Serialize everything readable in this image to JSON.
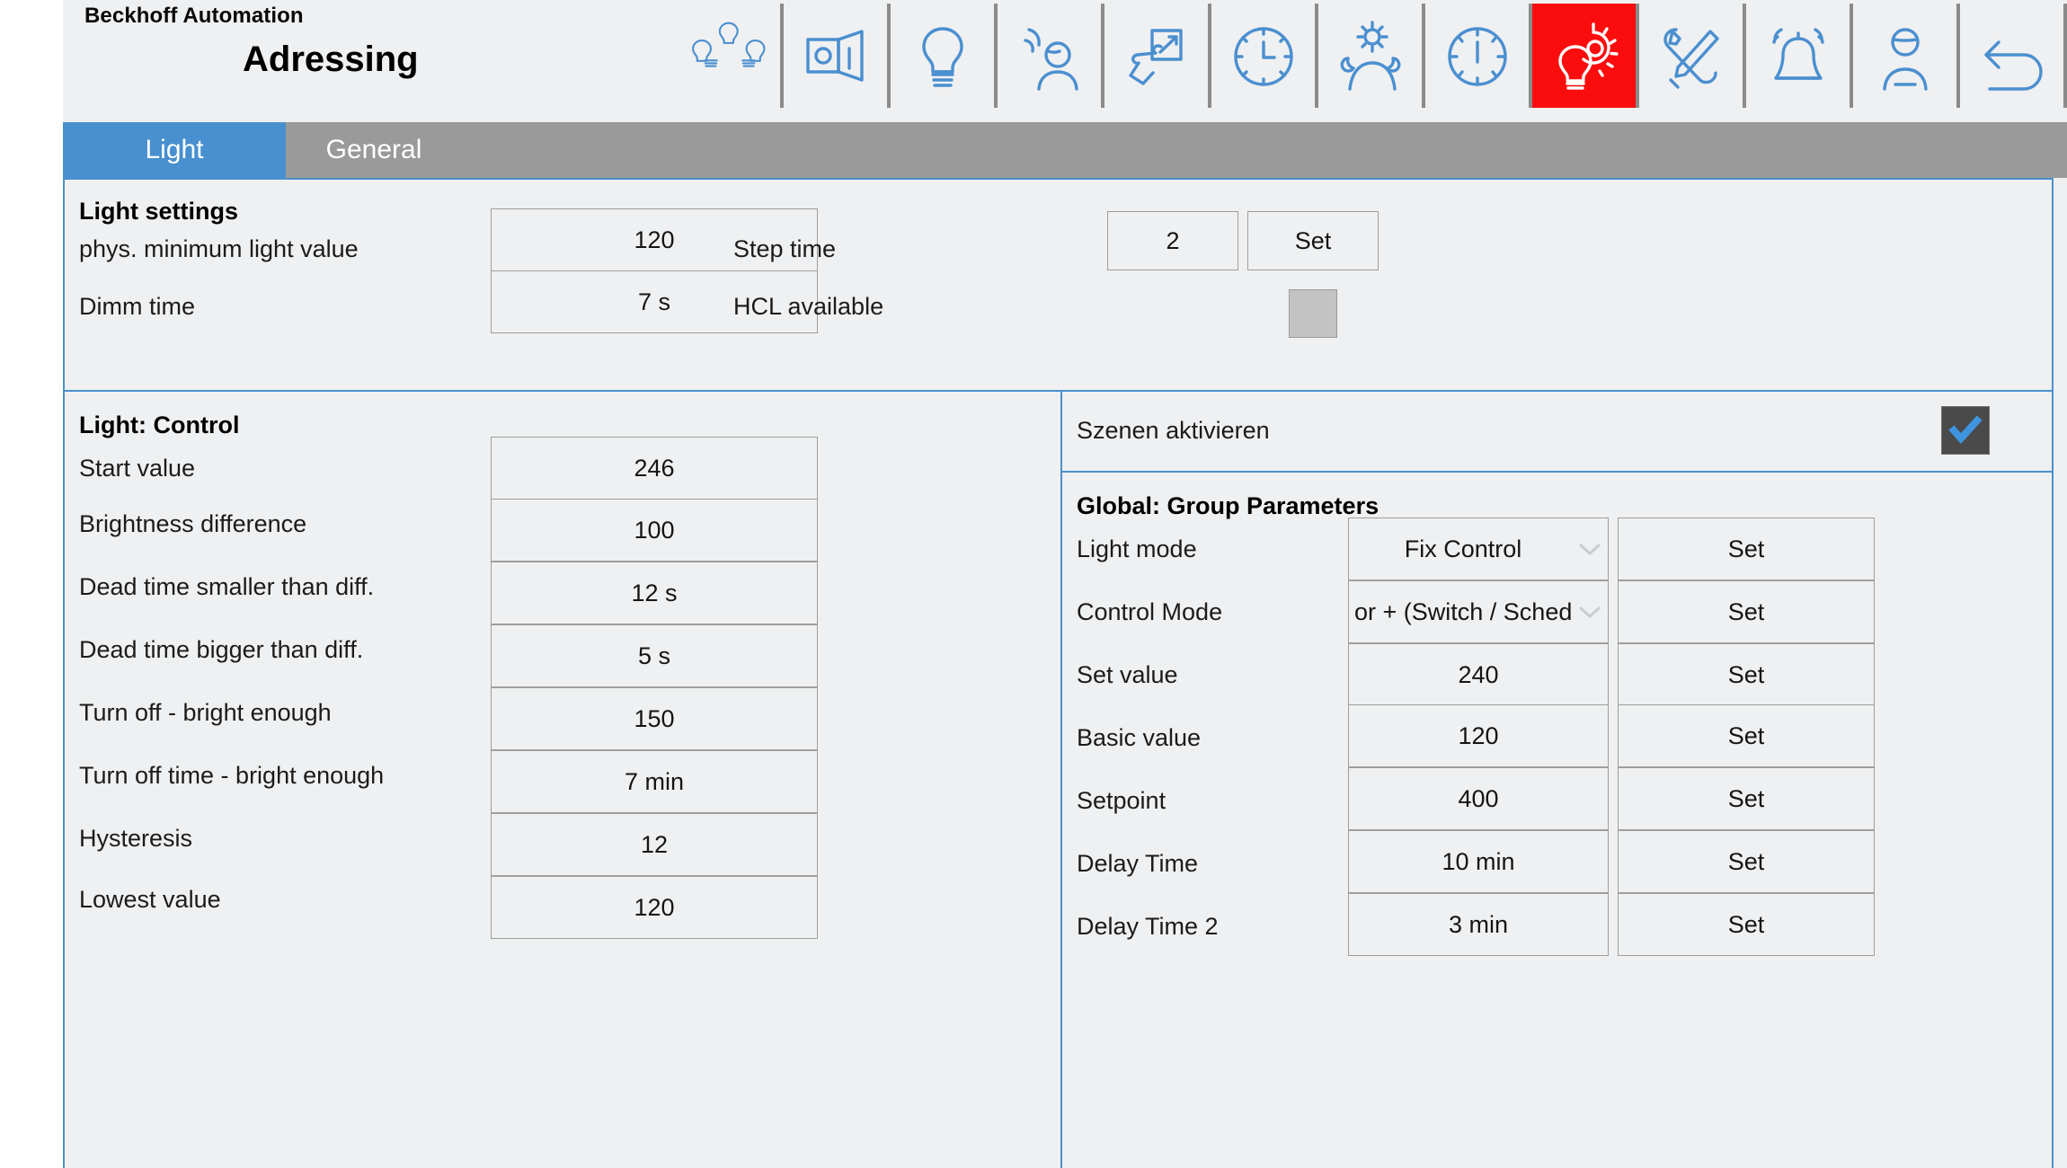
{
  "header": {
    "brand": "Beckhoff Automation",
    "title": "Adressing",
    "toolbar": [
      {
        "icon": "light-group-bulbs-icon",
        "active": false
      },
      {
        "icon": "room-view-icon",
        "active": false
      },
      {
        "icon": "light-bulb-icon",
        "active": false
      },
      {
        "icon": "presence-detector-icon",
        "active": false
      },
      {
        "icon": "hand-switch-icon",
        "active": false
      },
      {
        "icon": "clock-schedule-icon",
        "active": false
      },
      {
        "icon": "day-night-sun-moon-icon",
        "active": false
      },
      {
        "icon": "gauge-meter-icon",
        "active": false
      },
      {
        "icon": "light-settings-gear-icon",
        "active": true
      },
      {
        "icon": "tools-wrench-screwdriver-icon",
        "active": false
      },
      {
        "icon": "alarm-bell-icon",
        "active": false
      },
      {
        "icon": "service-person-icon",
        "active": false
      },
      {
        "icon": "back-undo-arrow-icon",
        "active": false
      }
    ]
  },
  "tabs": [
    {
      "label": "Light",
      "active": true
    },
    {
      "label": "General",
      "active": false
    }
  ],
  "light_settings": {
    "title": "Light settings",
    "left_rows": [
      {
        "label": "phys. minimum light value",
        "value": "120"
      },
      {
        "label": "Dimm time",
        "value": "7 s"
      }
    ],
    "right_rows": [
      {
        "label": "Step time",
        "value": "2",
        "button": "Set"
      },
      {
        "label": "HCL available",
        "checkbox": false
      }
    ]
  },
  "light_control": {
    "title": "Light: Control",
    "rows": [
      {
        "label": "Start value",
        "value": "246"
      },
      {
        "label": "Brightness difference",
        "value": "100"
      },
      {
        "label": "Dead time smaller than diff.",
        "value": "12 s"
      },
      {
        "label": "Dead time bigger than diff.",
        "value": "5 s"
      },
      {
        "label": "Turn off - bright enough",
        "value": "150"
      },
      {
        "label": "Turn off time - bright enough",
        "value": "7 min"
      },
      {
        "label": "Hysteresis",
        "value": "12"
      },
      {
        "label": "Lowest value",
        "value": "120"
      }
    ]
  },
  "scenes": {
    "label": "Szenen aktivieren",
    "checked": true
  },
  "global_group": {
    "title": "Global: Group Parameters",
    "rows": [
      {
        "label": "Light mode",
        "value": "Fix Control",
        "type": "combo",
        "button": "Set"
      },
      {
        "label": "Control Mode",
        "value": "or + (Switch / Sched",
        "type": "combo",
        "button": "Set"
      },
      {
        "label": "Set value",
        "value": "240",
        "type": "text",
        "button": "Set"
      },
      {
        "label": "Basic value",
        "value": "120",
        "type": "text",
        "button": "Set"
      },
      {
        "label": "Setpoint",
        "value": "400",
        "type": "text",
        "button": "Set"
      },
      {
        "label": "Delay Time",
        "value": "10 min",
        "type": "text",
        "button": "Set"
      },
      {
        "label": "Delay Time 2",
        "value": "3 min",
        "type": "text",
        "button": "Set"
      }
    ]
  },
  "colors": {
    "accent_blue": "#4890cf",
    "panel_border": "#4b90cc",
    "tabbar_grey": "#9a9a9a",
    "active_red": "#fc0d0d",
    "icon_blue": "#4a8fd0",
    "background": "#eff0f1"
  }
}
